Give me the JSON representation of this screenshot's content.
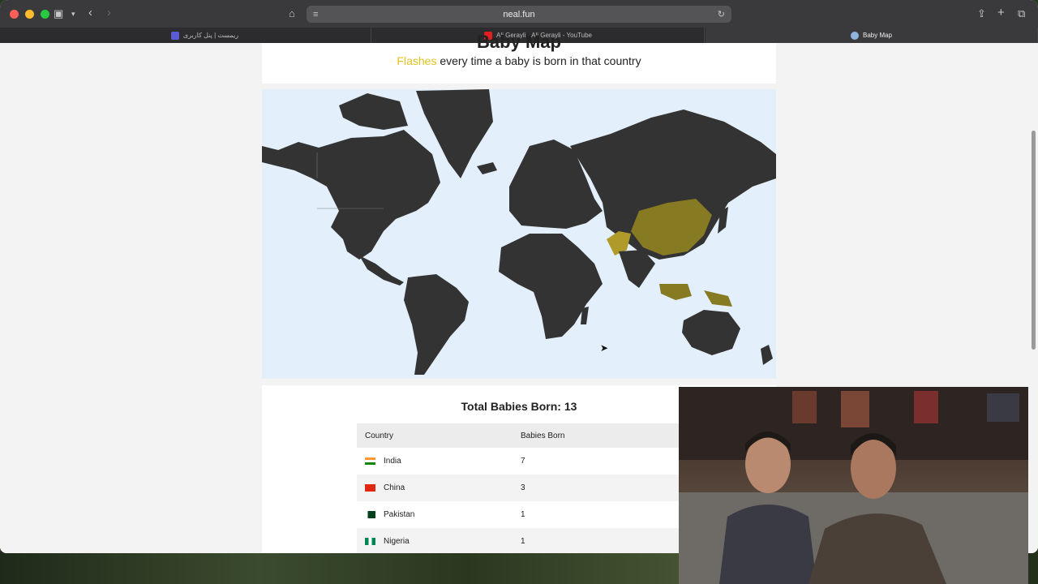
{
  "browser": {
    "url": "neal.fun",
    "tabs": [
      {
        "label": "ریمست | پنل کاربری"
      },
      {
        "label": "Ali Gerayli - Ali Gerayli - YouTube"
      },
      {
        "label": "Baby Map"
      }
    ]
  },
  "page": {
    "title": "Baby Map",
    "subtitle_highlight": "Flashes",
    "subtitle_rest": " every time a baby is born in that country",
    "total_label": "Total Babies Born: 13",
    "table": {
      "headers": [
        "Country",
        "Babies Born"
      ],
      "rows": [
        {
          "country": "India",
          "babies": "7"
        },
        {
          "country": "China",
          "babies": "3"
        },
        {
          "country": "Pakistan",
          "babies": "1"
        },
        {
          "country": "Nigeria",
          "babies": "1"
        }
      ]
    }
  },
  "colors": {
    "highlight": "#e0c220",
    "land": "#333333",
    "ocean": "#e3f0fb",
    "flashing_country": "#867a22"
  }
}
